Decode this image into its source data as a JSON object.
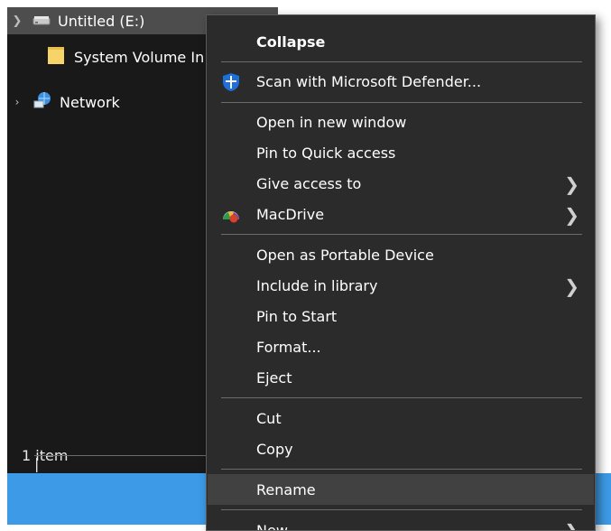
{
  "explorer": {
    "tree": [
      {
        "label": "Untitled (E:)",
        "expanded": true,
        "icon": "drive-icon"
      },
      {
        "label": "System Volume In",
        "icon": "folder-icon"
      },
      {
        "label": "Network",
        "expanded": false,
        "icon": "network-icon"
      }
    ],
    "status": {
      "count": "1 item",
      "separator": "|"
    }
  },
  "context_menu": {
    "items": [
      {
        "label": "Collapse"
      },
      {
        "label": "Scan with Microsoft Defender...",
        "icon": "defender-shield-icon"
      },
      {
        "label": "Open in new window"
      },
      {
        "label": "Pin to Quick access"
      },
      {
        "label": "Give access to",
        "submenu": true
      },
      {
        "label": "MacDrive",
        "icon": "macdrive-icon",
        "submenu": true
      },
      {
        "label": "Open as Portable Device"
      },
      {
        "label": "Include in library",
        "submenu": true
      },
      {
        "label": "Pin to Start"
      },
      {
        "label": "Format..."
      },
      {
        "label": "Eject"
      },
      {
        "label": "Cut"
      },
      {
        "label": "Copy"
      },
      {
        "label": "Rename"
      },
      {
        "label": "New",
        "submenu": true
      }
    ]
  },
  "colors": {
    "explorer_bg": "#191919",
    "menu_bg": "#2b2b2b",
    "selection_bg": "#4d4d4d",
    "hover_bg": "#414141",
    "taskbar": "#3d9ae6",
    "folder_yellow": "#f7d46a",
    "defender_blue": "#1e6fd9"
  }
}
